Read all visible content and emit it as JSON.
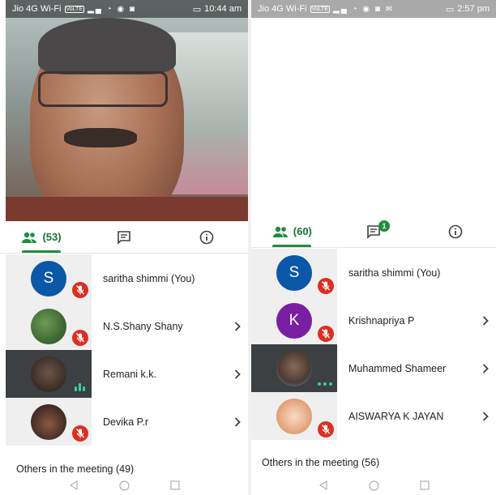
{
  "left": {
    "status": {
      "carrier": "Jio 4G Wi-Fi",
      "volte": "VoLTE",
      "time": "10:44 am"
    },
    "tabs": [
      {
        "icon": "people-icon",
        "label": "(53)",
        "active": true
      },
      {
        "icon": "chat-icon",
        "label": ""
      },
      {
        "icon": "info-icon",
        "label": ""
      }
    ],
    "participants": [
      {
        "name": "saritha shimmi (You)",
        "initial": "S",
        "muted": true
      },
      {
        "name": "N.S.Shany Shany",
        "initial": "",
        "muted": true
      },
      {
        "name": "Remani k.k.",
        "initial": "",
        "muted": false
      },
      {
        "name": "Devika P.r",
        "initial": "",
        "muted": true
      }
    ],
    "others": "Others in the meeting (49)"
  },
  "right": {
    "status": {
      "carrier": "Jio 4G Wi-Fi",
      "volte": "VoLTE",
      "time": "2:57 pm"
    },
    "tabs": [
      {
        "icon": "people-icon",
        "label": "(60)",
        "active": true
      },
      {
        "icon": "chat-icon",
        "label": "",
        "badge": "1"
      },
      {
        "icon": "info-icon",
        "label": ""
      }
    ],
    "participants": [
      {
        "name": "saritha shimmi (You)",
        "initial": "S",
        "muted": true
      },
      {
        "name": "Krishnapriya P",
        "initial": "K",
        "muted": true
      },
      {
        "name": "Muhammed Shameer",
        "initial": "",
        "muted": false
      },
      {
        "name": "AISWARYA K JAYAN",
        "initial": "",
        "muted": true
      }
    ],
    "others": "Others in the meeting (56)"
  },
  "colors": {
    "accent": "#1e8e3e",
    "mute": "#d93025",
    "avatar_blue": "#0b57a8",
    "avatar_purple": "#7b1fa2"
  }
}
